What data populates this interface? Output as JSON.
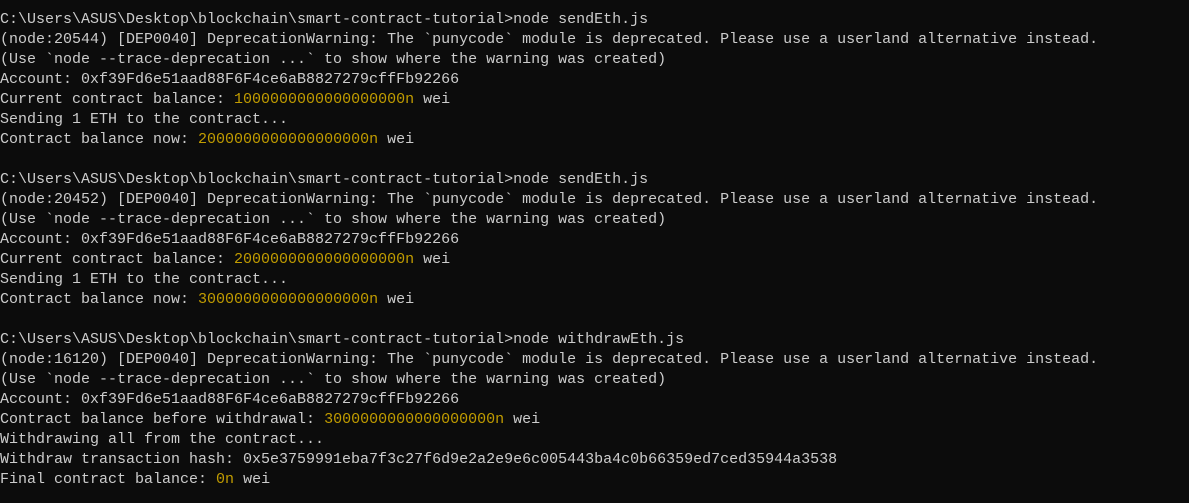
{
  "colors": {
    "background": "#0c0c0c",
    "text": "#cccccc",
    "number": "#c19c00"
  },
  "lines": [
    [
      {
        "t": "C:\\Users\\ASUS\\Desktop\\blockchain\\smart-contract-tutorial>node sendEth.js"
      }
    ],
    [
      {
        "t": "(node:20544) [DEP0040] DeprecationWarning: The `punycode` module is deprecated. Please use a userland alternative instead."
      }
    ],
    [
      {
        "t": "(Use `node --trace-deprecation ...` to show where the warning was created)"
      }
    ],
    [
      {
        "t": "Account: 0xf39Fd6e51aad88F6F4ce6aB8827279cffFb92266"
      }
    ],
    [
      {
        "t": "Current contract balance: "
      },
      {
        "t": "1000000000000000000n",
        "y": true
      },
      {
        "t": " wei"
      }
    ],
    [
      {
        "t": "Sending 1 ETH to the contract..."
      }
    ],
    [
      {
        "t": "Contract balance now: "
      },
      {
        "t": "2000000000000000000n",
        "y": true
      },
      {
        "t": " wei"
      }
    ],
    [],
    [
      {
        "t": "C:\\Users\\ASUS\\Desktop\\blockchain\\smart-contract-tutorial>node sendEth.js"
      }
    ],
    [
      {
        "t": "(node:20452) [DEP0040] DeprecationWarning: The `punycode` module is deprecated. Please use a userland alternative instead."
      }
    ],
    [
      {
        "t": "(Use `node --trace-deprecation ...` to show where the warning was created)"
      }
    ],
    [
      {
        "t": "Account: 0xf39Fd6e51aad88F6F4ce6aB8827279cffFb92266"
      }
    ],
    [
      {
        "t": "Current contract balance: "
      },
      {
        "t": "2000000000000000000n",
        "y": true
      },
      {
        "t": " wei"
      }
    ],
    [
      {
        "t": "Sending 1 ETH to the contract..."
      }
    ],
    [
      {
        "t": "Contract balance now: "
      },
      {
        "t": "3000000000000000000n",
        "y": true
      },
      {
        "t": " wei"
      }
    ],
    [],
    [
      {
        "t": "C:\\Users\\ASUS\\Desktop\\blockchain\\smart-contract-tutorial>node withdrawEth.js"
      }
    ],
    [
      {
        "t": "(node:16120) [DEP0040] DeprecationWarning: The `punycode` module is deprecated. Please use a userland alternative instead."
      }
    ],
    [
      {
        "t": "(Use `node --trace-deprecation ...` to show where the warning was created)"
      }
    ],
    [
      {
        "t": "Account: 0xf39Fd6e51aad88F6F4ce6aB8827279cffFb92266"
      }
    ],
    [
      {
        "t": "Contract balance before withdrawal: "
      },
      {
        "t": "3000000000000000000n",
        "y": true
      },
      {
        "t": " wei"
      }
    ],
    [
      {
        "t": "Withdrawing all from the contract..."
      }
    ],
    [
      {
        "t": "Withdraw transaction hash: 0x5e3759991eba7f3c27f6d9e2a2e9e6c005443ba4c0b66359ed7ced35944a3538"
      }
    ],
    [
      {
        "t": "Final contract balance: "
      },
      {
        "t": "0n",
        "y": true
      },
      {
        "t": " wei"
      }
    ]
  ]
}
